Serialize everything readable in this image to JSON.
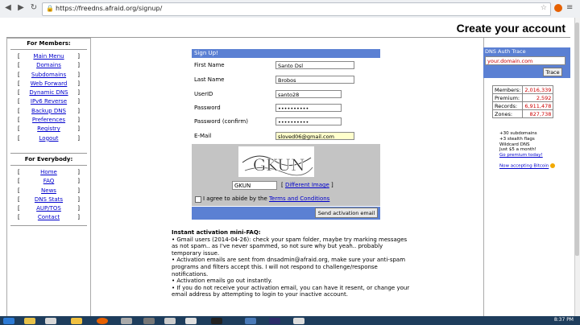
{
  "browser": {
    "url": "https://freedns.afraid.org/signup/",
    "back_glyph": "◀",
    "forward_glyph": "▶",
    "reload_glyph": "↻"
  },
  "page": {
    "title": "Create your account"
  },
  "left_nav": {
    "members_header": "For Members:",
    "members": [
      "Main Menu",
      "Domains",
      "Subdomains",
      "Web Forward",
      "Dynamic DNS",
      "IPv6 Reverse",
      "Backup DNS",
      "Preferences",
      "Registry",
      "Logout"
    ],
    "everybody_header": "For Everybody:",
    "everybody": [
      "Home",
      "FAQ",
      "News",
      "DNS Stats",
      "AUP/TOS",
      "Contact"
    ]
  },
  "form": {
    "header": "Sign Up!",
    "fields": {
      "first_name": {
        "label": "First Name",
        "value": "Santo Dsl"
      },
      "last_name": {
        "label": "Last Name",
        "value": "Brobos"
      },
      "userid": {
        "label": "UserID",
        "value": "santo28"
      },
      "password": {
        "label": "Password",
        "value": "••••••••••"
      },
      "password_confirm": {
        "label": "Password (confirm)",
        "value": "••••••••••"
      },
      "email": {
        "label": "E-Mail",
        "value": "sloved06@gmail.com"
      }
    },
    "captcha_text": "GKUN",
    "captcha_input": "GKUN",
    "different_image": "Different Image",
    "agree_prefix": "I agree to abide by the",
    "agree_link": "Terms and Conditions",
    "send_button": "Send activation email"
  },
  "faq": {
    "title": "Instant activation mini-FAQ:",
    "items": [
      "• Gmail users (2014-04-26): check your spam folder, maybe try marking messages as not spam.. as I've never spammed, so not sure why but yeah.. probably temporary issue.",
      "• Activation emails are sent from dnsadmin@afraid.org, make sure your anti-spam programs and filters accept this. I will not respond to challenge/response notifications.",
      "• Activation emails go out instantly.",
      "• If you do not receive your activation email, you can have it resent, or change your email address by attempting to login to your inactive account."
    ]
  },
  "right": {
    "trace_header": "DNS Auth Trace",
    "trace_input": "your.domain.com",
    "trace_button": "Trace",
    "stats": [
      {
        "label": "Members:",
        "value": "2,016,339"
      },
      {
        "label": "Premium:",
        "value": "2,592"
      },
      {
        "label": "Records:",
        "value": "6,911,478"
      },
      {
        "label": "Zones:",
        "value": "827,738"
      }
    ],
    "promo": [
      "+30 subdomains",
      "+3 stealth flags",
      "Wildcard DNS",
      "Just $5 a month!"
    ],
    "promo_link": "Go premium today!",
    "bitcoin": "Now accepting Bitcoin"
  },
  "taskbar": {
    "clock": "8:37 PM"
  },
  "colors": {
    "form_blue": "#5b80d3",
    "link": "#0000cc",
    "stat_red": "#cc0000"
  }
}
